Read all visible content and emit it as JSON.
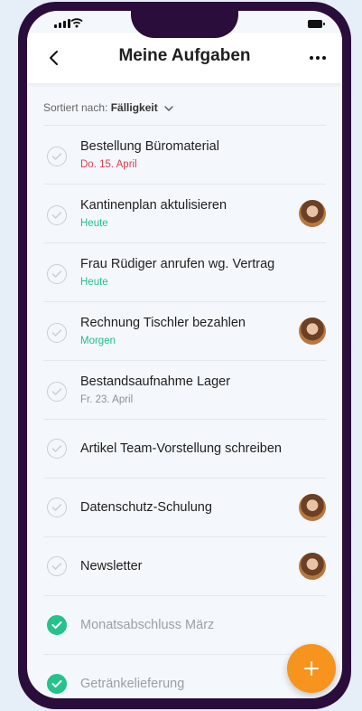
{
  "header": {
    "title": "Meine Aufgaben",
    "back_icon": "chevron-left-icon",
    "more_icon": "more-horizontal-icon"
  },
  "sort": {
    "prefix": "Sortiert nach:",
    "value": "Fälligkeit"
  },
  "tasks": [
    {
      "title": "Bestellung Büromaterial",
      "due": "Do. 15. April",
      "due_color": "#e03b4e",
      "avatar": false,
      "done": false
    },
    {
      "title": "Kantinenplan aktulisieren",
      "due": "Heute",
      "due_color": "#1fbf8f",
      "avatar": true,
      "done": false
    },
    {
      "title": "Frau Rüdiger anrufen wg. Vertrag",
      "due": "Heute",
      "due_color": "#1fbf8f",
      "avatar": false,
      "done": false
    },
    {
      "title": "Rechnung Tischler bezahlen",
      "due": "Morgen",
      "due_color": "#1fbf8f",
      "avatar": true,
      "done": false
    },
    {
      "title": "Bestandsaufnahme Lager",
      "due": "Fr. 23. April",
      "due_color": "#8a9097",
      "avatar": false,
      "done": false
    },
    {
      "title": "Artikel Team-Vorstellung schreiben",
      "due": "",
      "avatar": false,
      "done": false
    },
    {
      "title": "Datenschutz-Schulung",
      "due": "",
      "avatar": true,
      "done": false
    },
    {
      "title": "Newsletter",
      "due": "",
      "avatar": true,
      "done": false
    },
    {
      "title": "Monatsabschluss März",
      "due": "",
      "avatar": false,
      "done": true
    },
    {
      "title": "Getränkelieferung",
      "due": "",
      "avatar": false,
      "done": true
    }
  ],
  "colors": {
    "accent_fab": "#f7941d",
    "done_check": "#25c28c",
    "frame": "#2b0d3c"
  }
}
